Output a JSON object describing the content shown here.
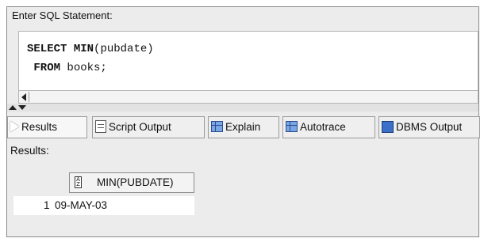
{
  "editor": {
    "header": "Enter SQL Statement:",
    "lines": [
      {
        "keyword": "SELECT",
        "rest_keyword": "MIN",
        "rest": "(pubdate)"
      },
      {
        "keyword": "FROM",
        "rest": " books;"
      }
    ]
  },
  "tabs": [
    {
      "label": "Results",
      "icon": "run-triangle-icon"
    },
    {
      "label": "Script Output",
      "icon": "script-output-icon"
    },
    {
      "label": "Explain",
      "icon": "explain-plan-icon"
    },
    {
      "label": "Autotrace",
      "icon": "autotrace-icon"
    },
    {
      "label": "DBMS Output",
      "icon": "dbms-output-icon"
    }
  ],
  "results": {
    "label": "Results:",
    "columns": [
      "MIN(PUBDATE)"
    ],
    "sort_icon_text": "A Z",
    "rows": [
      {
        "num": "1",
        "values": [
          "09-MAY-03"
        ]
      }
    ]
  }
}
